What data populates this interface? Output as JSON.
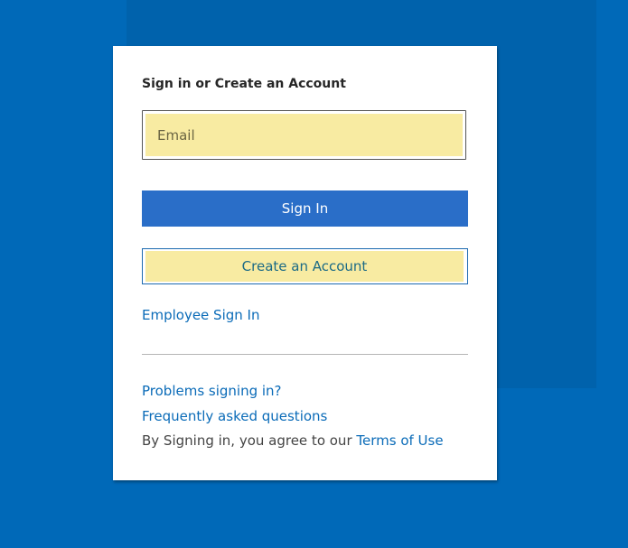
{
  "heading": "Sign in or Create an Account",
  "email": {
    "placeholder": "Email",
    "value": ""
  },
  "sign_in_label": "Sign In",
  "create_account_label": "Create an Account",
  "employee_sign_in": "Employee Sign In",
  "problems_link": "Problems signing in?",
  "faq_link": "Frequently asked questions",
  "terms": {
    "prefix": "By Signing in, you agree to our ",
    "link": "Terms of Use"
  },
  "colors": {
    "background": "#0069b8",
    "primary": "#2a6ec8",
    "link": "#0a6bb8",
    "autofill": "#f8eba2"
  }
}
